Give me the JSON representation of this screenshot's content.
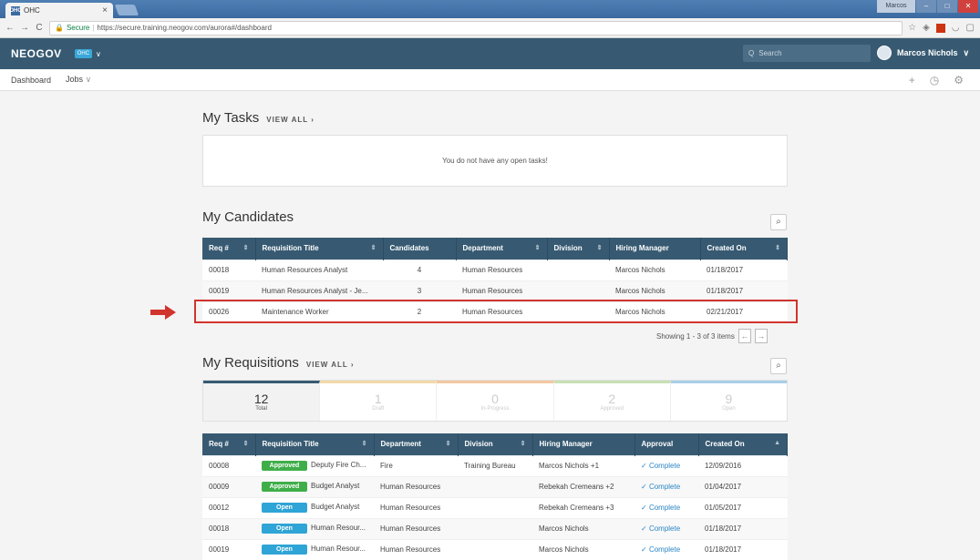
{
  "browser": {
    "tab_title": "OHC",
    "tab_favicon": "OHC",
    "secure_label": "Secure",
    "url": "https://secure.training.neogov.com/aurora#/dashboard",
    "window_user": "Marcos"
  },
  "header": {
    "brand": "NEOGOV",
    "app_badge": "OHC",
    "search_placeholder": "Search",
    "user_name": "Marcos Nichols"
  },
  "subnav": {
    "dashboard": "Dashboard",
    "jobs": "Jobs"
  },
  "tasks": {
    "title": "My Tasks",
    "view_all": "VIEW ALL",
    "empty_message": "You do not have any open tasks!"
  },
  "candidates": {
    "title": "My Candidates",
    "headers": [
      "Req #",
      "Requisition Title",
      "Candidates",
      "Department",
      "Division",
      "Hiring Manager",
      "Created On"
    ],
    "rows": [
      {
        "req": "00018",
        "title": "Human Resources Analyst",
        "candidates": "4",
        "department": "Human Resources",
        "division": "",
        "manager": "Marcos Nichols",
        "created": "01/18/2017"
      },
      {
        "req": "00019",
        "title": "Human Resources Analyst - Je...",
        "candidates": "3",
        "department": "Human Resources",
        "division": "",
        "manager": "Marcos Nichols",
        "created": "01/18/2017"
      },
      {
        "req": "00026",
        "title": "Maintenance Worker",
        "candidates": "2",
        "department": "Human Resources",
        "division": "",
        "manager": "Marcos Nichols",
        "created": "02/21/2017"
      }
    ],
    "pager_text": "Showing 1 - 3 of 3 items"
  },
  "requisitions": {
    "title": "My Requisitions",
    "view_all": "VIEW ALL",
    "stats": [
      {
        "count": "12",
        "label": "Total"
      },
      {
        "count": "1",
        "label": "Draft"
      },
      {
        "count": "0",
        "label": "In-Progress"
      },
      {
        "count": "2",
        "label": "Approved"
      },
      {
        "count": "9",
        "label": "Open"
      }
    ],
    "stat_colors": [
      "#375a72",
      "#f3d9a8",
      "#f3c8a0",
      "#c9e0b5",
      "#a9cfe8"
    ],
    "headers": [
      "Req #",
      "Requisition Title",
      "Department",
      "Division",
      "Hiring Manager",
      "Approval",
      "Created On"
    ],
    "rows": [
      {
        "req": "00008",
        "status": "Approved",
        "title": "Deputy Fire Ch...",
        "department": "Fire",
        "division": "Training Bureau",
        "manager": "Marcos Nichols +1",
        "approval": "Complete",
        "created": "12/09/2016"
      },
      {
        "req": "00009",
        "status": "Approved",
        "title": "Budget Analyst",
        "department": "Human Resources",
        "division": "",
        "manager": "Rebekah Cremeans +2",
        "approval": "Complete",
        "created": "01/04/2017"
      },
      {
        "req": "00012",
        "status": "Open",
        "title": "Budget Analyst",
        "department": "Human Resources",
        "division": "",
        "manager": "Rebekah Cremeans +3",
        "approval": "Complete",
        "created": "01/05/2017"
      },
      {
        "req": "00018",
        "status": "Open",
        "title": "Human Resour...",
        "department": "Human Resources",
        "division": "",
        "manager": "Marcos Nichols",
        "approval": "Complete",
        "created": "01/18/2017"
      },
      {
        "req": "00019",
        "status": "Open",
        "title": "Human Resour...",
        "department": "Human Resources",
        "division": "",
        "manager": "Marcos Nichols",
        "approval": "Complete",
        "created": "01/18/2017"
      }
    ],
    "status_colors": {
      "Approved": "#3fae49",
      "Open": "#2fa4d6"
    }
  },
  "annotation": {
    "highlight_color": "#d0342c"
  }
}
